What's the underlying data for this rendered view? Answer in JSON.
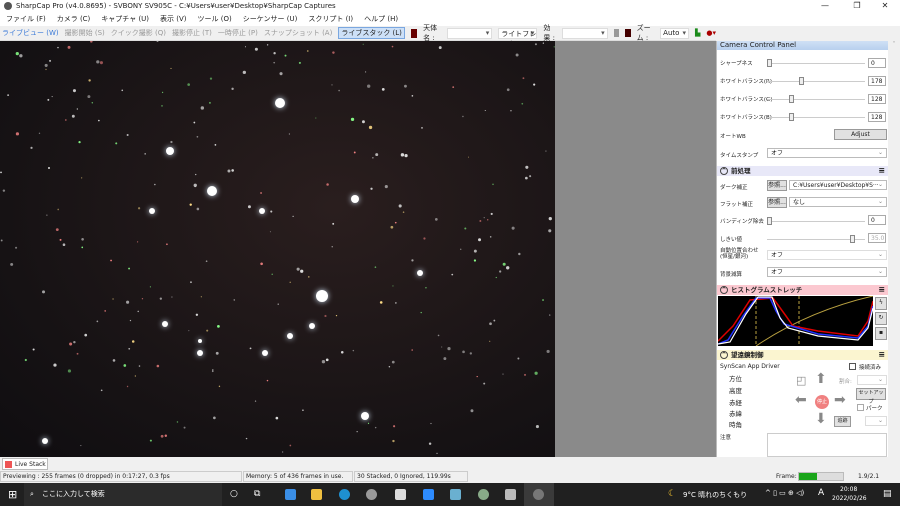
{
  "window": {
    "title": "SharpCap Pro (v4.0.8695) - SVBONY SV905C - C:¥Users¥user¥Desktop¥SharpCap Captures"
  },
  "menu": [
    "ファイル (F)",
    "カメラ (C)",
    "キャプチャ (U)",
    "表示 (V)",
    "ツール (O)",
    "シーケンサー (U)",
    "スクリプト (I)",
    "ヘルプ (H)"
  ],
  "toolbar": {
    "live_view": "ライブビュー (W)",
    "start_capture": "撮影開始 (S)",
    "quick_capture": "クイック撮影 (Q)",
    "stop_capture": "撮影停止 (T)",
    "pause": "一時停止 (P)",
    "snapshot": "スナップショット (A)",
    "live_stack": "ライブスタック (L)",
    "target_label": "天体名 :",
    "target_value": "",
    "frame_type": "ライトフレーム",
    "effect_label": "効果 :",
    "effect_value": "",
    "zoom_label": "ズーム :",
    "zoom_value": "Auto"
  },
  "panel": {
    "title": "Camera Control Panel",
    "sharpness": {
      "label": "シャープネス",
      "value": "0"
    },
    "wb_r": {
      "label": "ホワイトバランス(R)",
      "value": "178"
    },
    "wb_g": {
      "label": "ホワイトバランス(G)",
      "value": "128"
    },
    "wb_b": {
      "label": "ホワイトバランス(B)",
      "value": "128"
    },
    "auto_wb": {
      "label": "オートWB",
      "button": "Adjust"
    },
    "timestamp": {
      "label": "タイムスタンプ",
      "value": "オフ"
    },
    "preprocess": {
      "title": "前処理",
      "dark": {
        "label": "ダーク補正",
        "browse": "参照...",
        "value": "C:¥Users¥user¥Desktop¥S···"
      },
      "flat": {
        "label": "フラット補正",
        "browse": "参照...",
        "value": "なし"
      },
      "banding": {
        "label": "バンディング除去",
        "value": "0"
      },
      "threshold": {
        "label": "しきい値",
        "value": "35.0"
      },
      "align": {
        "label": "自動位置合わせ\n(恒星/銀河)",
        "value": "オフ"
      },
      "bg": {
        "label": "背景減算",
        "value": "オフ"
      }
    },
    "histogram": {
      "title": "ヒストグラムストレッチ"
    },
    "mount": {
      "title": "望遠鏡制御",
      "driver": "SynScan App Driver",
      "connected": "接続済み",
      "rate_label": "割合:",
      "labels": [
        "方位",
        "高度",
        "赤経",
        "赤緯",
        "時角"
      ],
      "stop": "停止",
      "setup": "セットアップ",
      "park": "パーク",
      "track": "追跡",
      "notes": "注意"
    }
  },
  "livestack_tab": "Live Stack",
  "status": {
    "preview": "Previewing : 255 frames (0 dropped) in 0:17:27, 0.3 fps",
    "memory": "Memory: 5 of 436 frames in use.",
    "stack": "30 Stacked, 0 Ignored, 119.99s",
    "frame_label": "Frame:",
    "frame_progress": 0.4,
    "ratio": "1.9/2.1"
  },
  "taskbar": {
    "search": "ここに入力して検索",
    "weather": "9°C 晴れのちくもり",
    "ime": "A",
    "time": "20:08",
    "date": "2022/02/26"
  }
}
